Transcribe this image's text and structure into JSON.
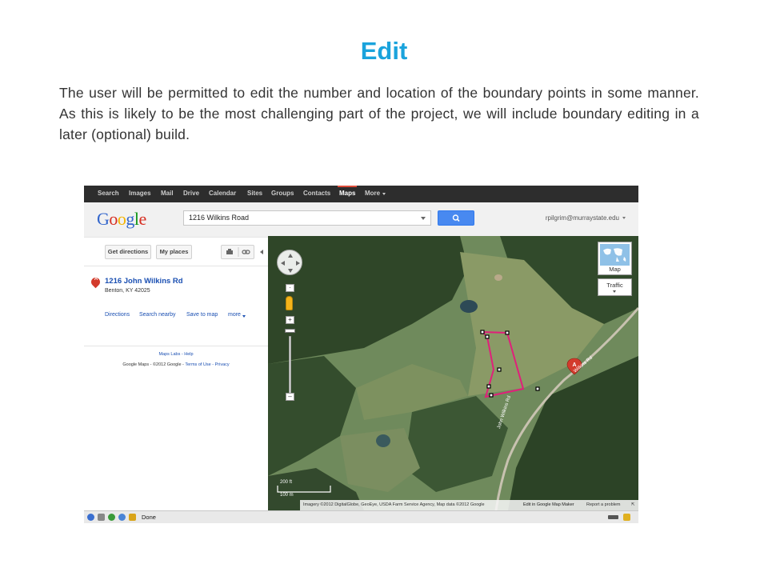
{
  "slide": {
    "title": "Edit",
    "body": "The user will be permitted to edit the number and location of the boundary points in some manner.  As this is likely to be the most challenging part of the project, we will include boundary editing in a later (optional) build."
  },
  "gbar": {
    "items": [
      "Search",
      "Images",
      "Mail",
      "Drive",
      "Calendar",
      "Sites",
      "Groups",
      "Contacts",
      "Maps",
      "More"
    ],
    "active": "Maps"
  },
  "header": {
    "logo": [
      "G",
      "o",
      "o",
      "g",
      "l",
      "e"
    ],
    "logo_colors": [
      "#3366cc",
      "#d62d20",
      "#f4b400",
      "#3366cc",
      "#109618",
      "#d62d20"
    ],
    "search_value": "1216 Wilkins Road",
    "user_email": "rpilgrim@murraystate.edu"
  },
  "left_panel": {
    "get_directions": "Get directions",
    "my_places": "My places",
    "pin_letter": "A",
    "place_name": "1216 John Wilkins Rd",
    "place_address": "Benton, KY 42025",
    "actions": [
      "Directions",
      "Search nearby",
      "Save to map",
      "more"
    ],
    "footer_links": "Maps Labs - Help",
    "footer_copyright": "Google Maps - ©2012 Google - ",
    "footer_terms": "Terms of Use - Privacy"
  },
  "map": {
    "map_type_label": "Map",
    "traffic_label": "Traffic",
    "scale_ft": "200 ft",
    "scale_m": "100 m",
    "road_label_1": "Wilkins Rd",
    "road_label_2": "John Wilkins Rd",
    "marker_letter": "A",
    "attribution": "Imagery ©2012 DigitalGlobe, GeoEye, USDA Farm Service Agency, Map data ©2012 Google",
    "edit_link": "Edit in Google Map Maker",
    "report_link": "Report a problem"
  },
  "statusbar": {
    "text": "Done"
  },
  "colors": {
    "title": "#1aa3dc",
    "boundary": "#e0207a",
    "search_button": "#4889f0",
    "link": "#1a4fb2"
  }
}
